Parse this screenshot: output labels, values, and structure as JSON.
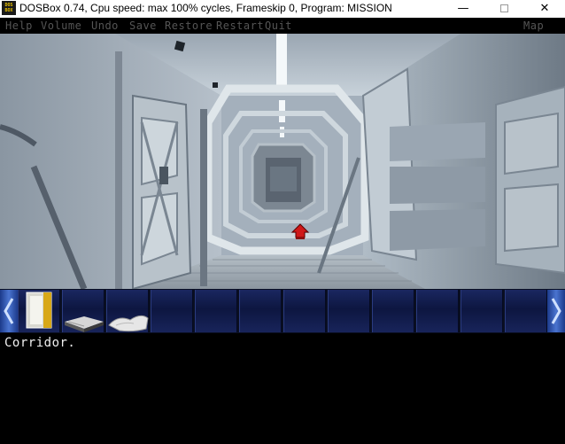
{
  "window": {
    "icon_text": "DOS BOX",
    "title": "DOSBox 0.74, Cpu speed: max 100% cycles, Frameskip  0, Program:  MISSION",
    "minimize_glyph": "—",
    "close_glyph": "✕"
  },
  "menu": {
    "items": [
      "Help",
      "Volume",
      "Undo",
      "Save",
      "Restore",
      "Restart",
      "Quit"
    ],
    "map_label": "Map"
  },
  "scene": {
    "location": "corridor",
    "cursor": "red-arrow-up-icon"
  },
  "inventory": {
    "items": [
      {
        "name": "keycard-icon"
      },
      {
        "name": "book-icon"
      },
      {
        "name": "paper-icon"
      }
    ],
    "empty_slot_count": 9,
    "left_arrow": "chevron-left-icon",
    "right_arrow": "chevron-right-icon"
  },
  "text_output": {
    "message": "Corridor."
  },
  "colors": {
    "menu_text": "#555555",
    "inventory_bg": "#0d1640",
    "arrow_blue": "#4a74d0",
    "cursor_red": "#d01818"
  }
}
